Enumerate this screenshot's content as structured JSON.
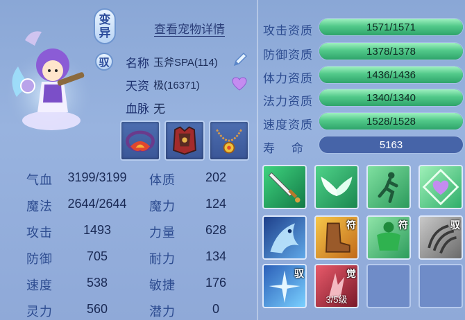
{
  "pet": {
    "mutant_badge": [
      "变",
      "异"
    ],
    "tame_badge": "驭",
    "detail_link": "查看宠物详情",
    "name_label": "名称",
    "name_value": "玉斧SPA(114)",
    "aptitude_label": "天资",
    "aptitude_value": "极(16371)",
    "bloodline_label": "血脉",
    "bloodline_value": "无"
  },
  "attributes": [
    {
      "label": "气血",
      "value": "3199/3199",
      "label2": "体质",
      "value2": "202"
    },
    {
      "label": "魔法",
      "value": "2644/2644",
      "label2": "魔力",
      "value2": "124"
    },
    {
      "label": "攻击",
      "value": "1493",
      "label2": "力量",
      "value2": "628"
    },
    {
      "label": "防御",
      "value": "705",
      "label2": "耐力",
      "value2": "134"
    },
    {
      "label": "速度",
      "value": "538",
      "label2": "敏捷",
      "value2": "176"
    },
    {
      "label": "灵力",
      "value": "560",
      "label2": "潜力",
      "value2": "0"
    }
  ],
  "aptitudes": [
    {
      "label": "攻击资质",
      "value": "1571/1571",
      "fill": 1.0
    },
    {
      "label": "防御资质",
      "value": "1378/1378",
      "fill": 1.0
    },
    {
      "label": "体力资质",
      "value": "1436/1436",
      "fill": 1.0
    },
    {
      "label": "法力资质",
      "value": "1340/1340",
      "fill": 1.0
    },
    {
      "label": "速度资质",
      "value": "1528/1528",
      "fill": 1.0
    }
  ],
  "life": {
    "label": "寿    命",
    "value": "5163"
  },
  "skills": [
    {
      "icon": "sword-skill-icon",
      "tag": ""
    },
    {
      "icon": "wings-skill-icon",
      "tag": ""
    },
    {
      "icon": "runner-skill-icon",
      "tag": ""
    },
    {
      "icon": "heart-skill-icon",
      "tag": ""
    },
    {
      "icon": "ice-dragon-skill-icon",
      "tag": ""
    },
    {
      "icon": "boot-skill-icon",
      "tag": "符"
    },
    {
      "icon": "muscle-skill-icon",
      "tag": "符"
    },
    {
      "icon": "claw-skill-icon",
      "tag": "驭"
    },
    {
      "icon": "ice-burst-skill-icon",
      "tag": "驭"
    },
    {
      "icon": "awaken-skill-icon",
      "tag": "觉",
      "level": "3/5级"
    },
    {
      "icon": "empty-slot",
      "tag": ""
    },
    {
      "icon": "empty-slot",
      "tag": ""
    }
  ]
}
